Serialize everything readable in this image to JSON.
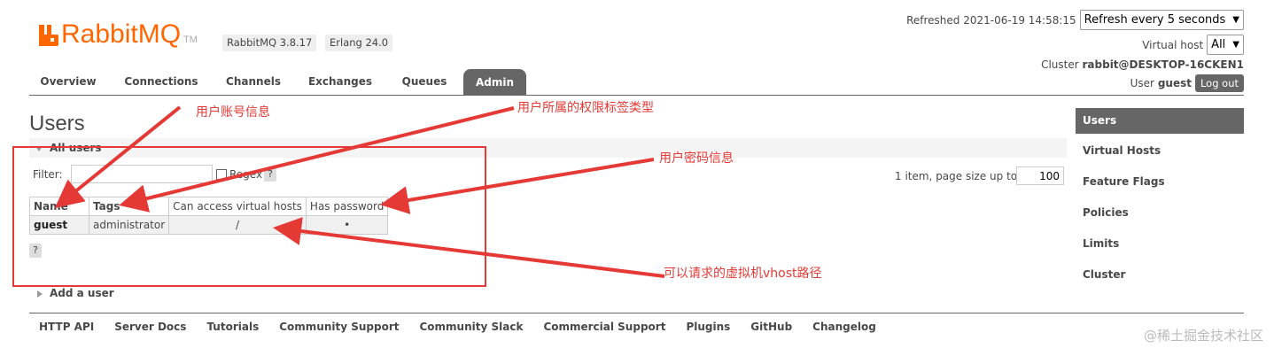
{
  "brand": {
    "name_rabbit": "Rabbit",
    "name_mq": "MQ",
    "tm": "TM",
    "rabbit_version": "RabbitMQ 3.8.17",
    "erlang_version": "Erlang 24.0",
    "brand_color": "#ff6600"
  },
  "status": {
    "refreshed": "Refreshed 2021-06-19 14:58:15",
    "refresh_select": "Refresh every 5 seconds",
    "vhost_label": "Virtual host",
    "vhost_select": "All",
    "cluster_label": "Cluster",
    "cluster_name": "rabbit@DESKTOP-16CKEN1",
    "user_label": "User",
    "user_name": "guest",
    "logout": "Log out"
  },
  "tabs": [
    {
      "label": "Overview"
    },
    {
      "label": "Connections"
    },
    {
      "label": "Channels"
    },
    {
      "label": "Exchanges"
    },
    {
      "label": "Queues"
    },
    {
      "label": "Admin",
      "active": true
    }
  ],
  "main": {
    "title": "Users",
    "section_title": "All users",
    "filter_label": "Filter:",
    "filter_value": "",
    "regex_label": "Regex",
    "help": "?",
    "page_info": "1 item, page size up to",
    "page_size": "100",
    "add_user": "Add a user"
  },
  "table": {
    "headers": [
      "Name",
      "Tags",
      "Can access virtual hosts",
      "Has password"
    ],
    "rows": [
      {
        "name": "guest",
        "tags": "administrator",
        "vhosts": "/",
        "has_password": "•"
      }
    ]
  },
  "sidebar": {
    "items": [
      {
        "label": "Users",
        "active": true
      },
      {
        "label": "Virtual Hosts"
      },
      {
        "label": "Feature Flags"
      },
      {
        "label": "Policies"
      },
      {
        "label": "Limits"
      },
      {
        "label": "Cluster"
      }
    ]
  },
  "footer": {
    "links": [
      "HTTP API",
      "Server Docs",
      "Tutorials",
      "Community Support",
      "Community Slack",
      "Commercial Support",
      "Plugins",
      "GitHub",
      "Changelog"
    ]
  },
  "annotations": {
    "user_account": "用户账号信息",
    "user_tags": "用户所属的权限标签类型",
    "user_password": "用户密码信息",
    "vhost_path": "可以请求的虚拟机vhost路径",
    "color": "#e53935"
  },
  "watermark": "@稀土掘金技术社区"
}
